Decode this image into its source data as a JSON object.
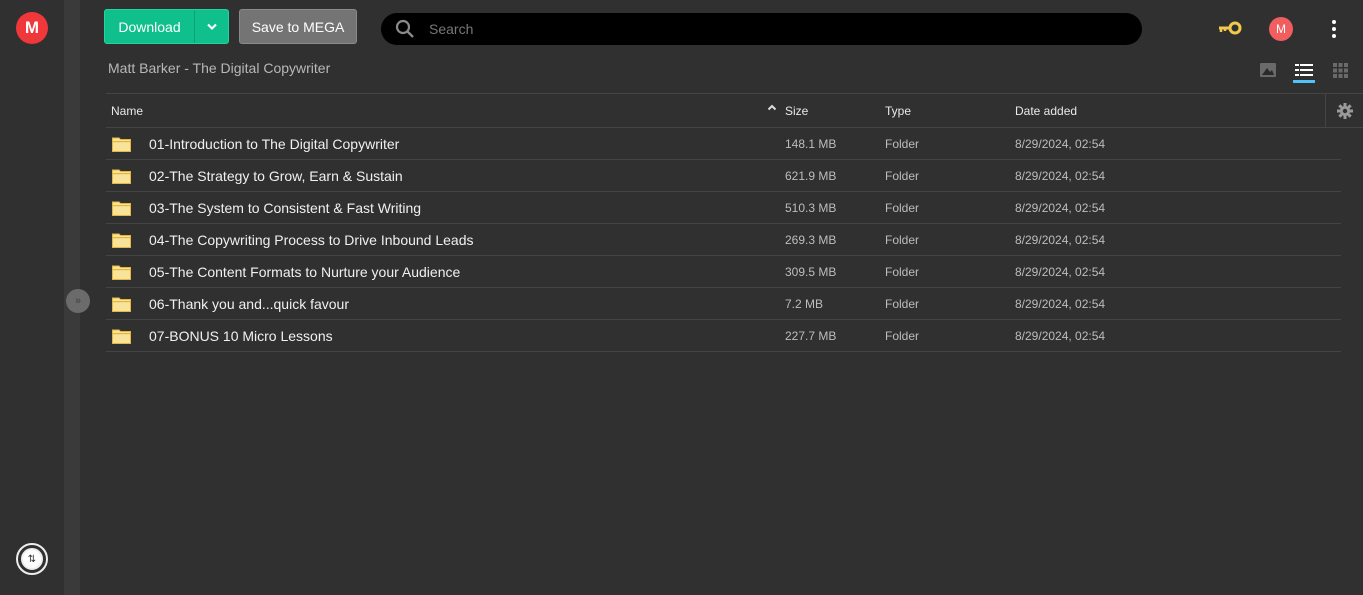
{
  "app": {
    "logo_letter": "M"
  },
  "toolbar": {
    "download_label": "Download",
    "save_label": "Save to MEGA",
    "search_placeholder": "Search",
    "avatar_letter": "M"
  },
  "breadcrumb": "Matt Barker - The Digital Copywriter",
  "view_modes": [
    "thumbnail-view",
    "list-view",
    "grid-view"
  ],
  "active_view": "list-view",
  "table": {
    "columns": {
      "name": "Name",
      "size": "Size",
      "type": "Type",
      "date": "Date added"
    },
    "rows": [
      {
        "name": "01-Introduction to The Digital Copywriter",
        "size": "148.1 MB",
        "type": "Folder",
        "date": "8/29/2024, 02:54"
      },
      {
        "name": "02-The Strategy to Grow, Earn & Sustain",
        "size": "621.9 MB",
        "type": "Folder",
        "date": "8/29/2024, 02:54"
      },
      {
        "name": "03-The System to Consistent & Fast Writing",
        "size": "510.3 MB",
        "type": "Folder",
        "date": "8/29/2024, 02:54"
      },
      {
        "name": "04-The Copywriting Process to Drive Inbound Leads",
        "size": "269.3 MB",
        "type": "Folder",
        "date": "8/29/2024, 02:54"
      },
      {
        "name": "05-The Content Formats to Nurture your Audience",
        "size": "309.5 MB",
        "type": "Folder",
        "date": "8/29/2024, 02:54"
      },
      {
        "name": "06-Thank you and...quick favour",
        "size": "7.2 MB",
        "type": "Folder",
        "date": "8/29/2024, 02:54"
      },
      {
        "name": "07-BONUS 10 Micro Lessons",
        "size": "227.7 MB",
        "type": "Folder",
        "date": "8/29/2024, 02:54"
      }
    ]
  },
  "colors": {
    "accent_green": "#0fbf8c",
    "brand_red": "#f0373a",
    "active_tab": "#4fc3f7",
    "key_gold": "#f2c94c"
  }
}
